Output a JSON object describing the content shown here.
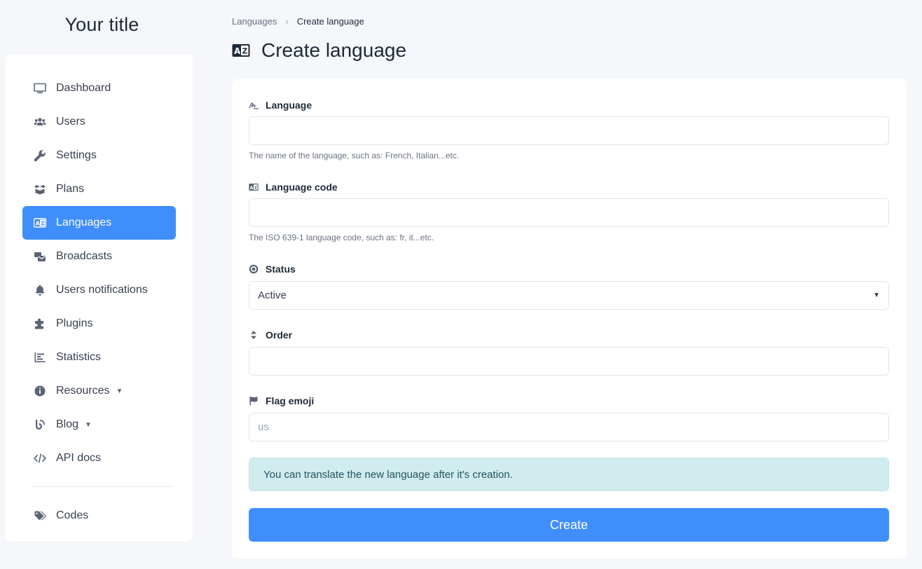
{
  "sidebar": {
    "title": "Your title",
    "items": [
      {
        "label": "Dashboard",
        "icon": "monitor-icon"
      },
      {
        "label": "Users",
        "icon": "users-icon"
      },
      {
        "label": "Settings",
        "icon": "wrench-icon"
      },
      {
        "label": "Plans",
        "icon": "box-icon"
      },
      {
        "label": "Languages",
        "icon": "language-icon"
      },
      {
        "label": "Broadcasts",
        "icon": "mail-bulk-icon"
      },
      {
        "label": "Users notifications",
        "icon": "bell-icon"
      },
      {
        "label": "Plugins",
        "icon": "puzzle-icon"
      },
      {
        "label": "Statistics",
        "icon": "chart-icon"
      },
      {
        "label": "Resources",
        "icon": "info-icon"
      },
      {
        "label": "Blog",
        "icon": "blog-icon"
      },
      {
        "label": "API docs",
        "icon": "code-icon"
      }
    ],
    "codes_label": "Codes"
  },
  "breadcrumb": {
    "parent": "Languages",
    "current": "Create language"
  },
  "page": {
    "title": "Create language"
  },
  "form": {
    "language": {
      "label": "Language",
      "value": "",
      "help": "The name of the language, such as: French, Italian...etc."
    },
    "language_code": {
      "label": "Language code",
      "value": "",
      "help": "The ISO 639-1 language code, such as: fr, it...etc."
    },
    "status": {
      "label": "Status",
      "selected": "Active"
    },
    "order": {
      "label": "Order",
      "value": ""
    },
    "flag_emoji": {
      "label": "Flag emoji",
      "placeholder": "us"
    },
    "alert": "You can translate the new language after it's creation.",
    "submit_label": "Create"
  },
  "colors": {
    "accent": "#3f8efc",
    "alert_bg": "#d1ecef",
    "background": "#f5f7fa"
  }
}
